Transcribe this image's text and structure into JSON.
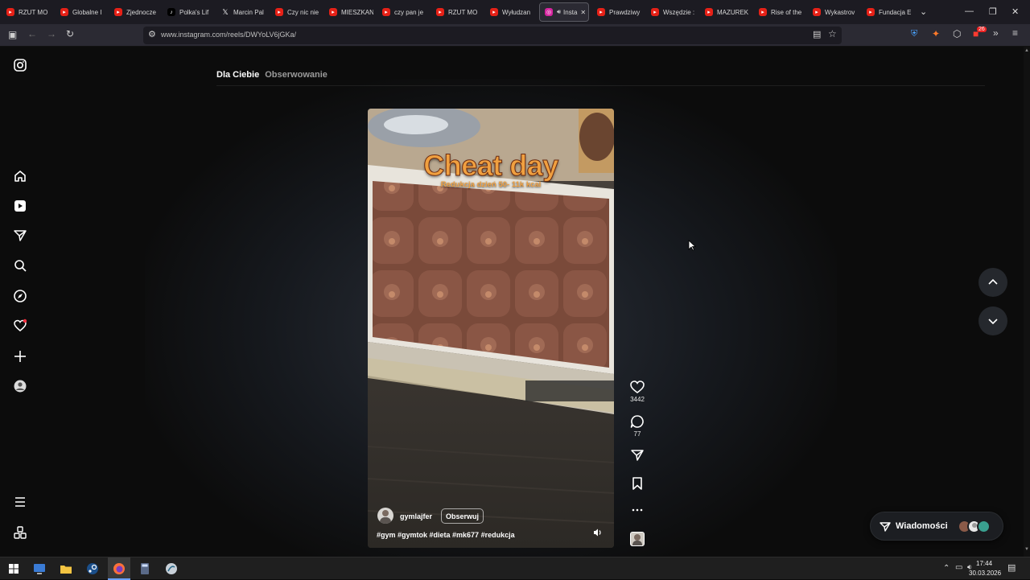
{
  "browser": {
    "tabs": [
      {
        "title": "RZUT MO",
        "kind": "yt"
      },
      {
        "title": "Globalne I",
        "kind": "yt"
      },
      {
        "title": "Zjednocze",
        "kind": "yt"
      },
      {
        "title": "Polka's Lif",
        "kind": "tiktok"
      },
      {
        "title": "Marcin Pal",
        "kind": "x"
      },
      {
        "title": "Czy nic nie",
        "kind": "yt"
      },
      {
        "title": "MIESZKAN",
        "kind": "yt"
      },
      {
        "title": "czy pan je",
        "kind": "yt"
      },
      {
        "title": "RZUT MO",
        "kind": "yt"
      },
      {
        "title": "Wyłudzan",
        "kind": "yt"
      },
      {
        "title": "Insta",
        "kind": "ig",
        "active": true
      },
      {
        "title": "Prawdziwy",
        "kind": "yt"
      },
      {
        "title": "Wszędzie :",
        "kind": "yt"
      },
      {
        "title": "MAZUREK",
        "kind": "yt"
      },
      {
        "title": "Rise of the",
        "kind": "yt"
      },
      {
        "title": "Wykastrov",
        "kind": "yt"
      },
      {
        "title": "Fundacja E",
        "kind": "yt"
      }
    ],
    "url": "www.instagram.com/reels/DWYoLV6jGKa/",
    "extension_badge": "26",
    "icons": {
      "back": "arrow-left-icon",
      "forward": "arrow-right-icon",
      "reload": "reload-icon"
    }
  },
  "feed": {
    "tab_active": "Dla Ciebie",
    "tab_inactive": "Obserwowanie"
  },
  "reel": {
    "overlay_title": "Cheat day",
    "overlay_subtitle": "Redukcja dzień 50- 11k kcal",
    "username": "gymlajfer",
    "follow_label": "Obserwuj",
    "caption": "#gym #gymtok #dieta #mk677 #redukcja",
    "likes": "3442",
    "comments": "77"
  },
  "messages": {
    "label": "Wiadomości"
  },
  "taskbar": {
    "time": "17:44",
    "date": "30.03.2026"
  },
  "colors": {
    "youtube": "#e62117",
    "accent": "#f0a040",
    "notification": "#ff3040",
    "background": "#0c0c0c"
  }
}
